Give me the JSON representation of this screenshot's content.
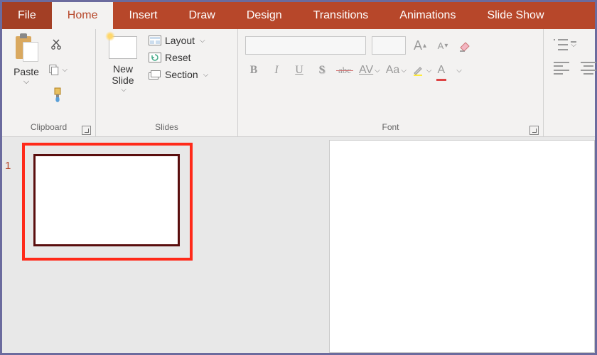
{
  "tabs": {
    "file": "File",
    "home": "Home",
    "insert": "Insert",
    "draw": "Draw",
    "design": "Design",
    "transitions": "Transitions",
    "animations": "Animations",
    "slideshow": "Slide Show"
  },
  "active_tab": "Home",
  "ribbon": {
    "clipboard": {
      "label": "Clipboard",
      "paste": "Paste"
    },
    "slides": {
      "label": "Slides",
      "new_slide": "New\nSlide",
      "layout": "Layout",
      "reset": "Reset",
      "section": "Section"
    },
    "font": {
      "label": "Font",
      "bold": "B",
      "italic": "I",
      "underline": "U",
      "shadow": "S",
      "strike": "abc",
      "spacing": "AV",
      "case": "Aa",
      "clear": "A",
      "increase": "A",
      "decrease": "A"
    }
  },
  "slide_number": "1"
}
